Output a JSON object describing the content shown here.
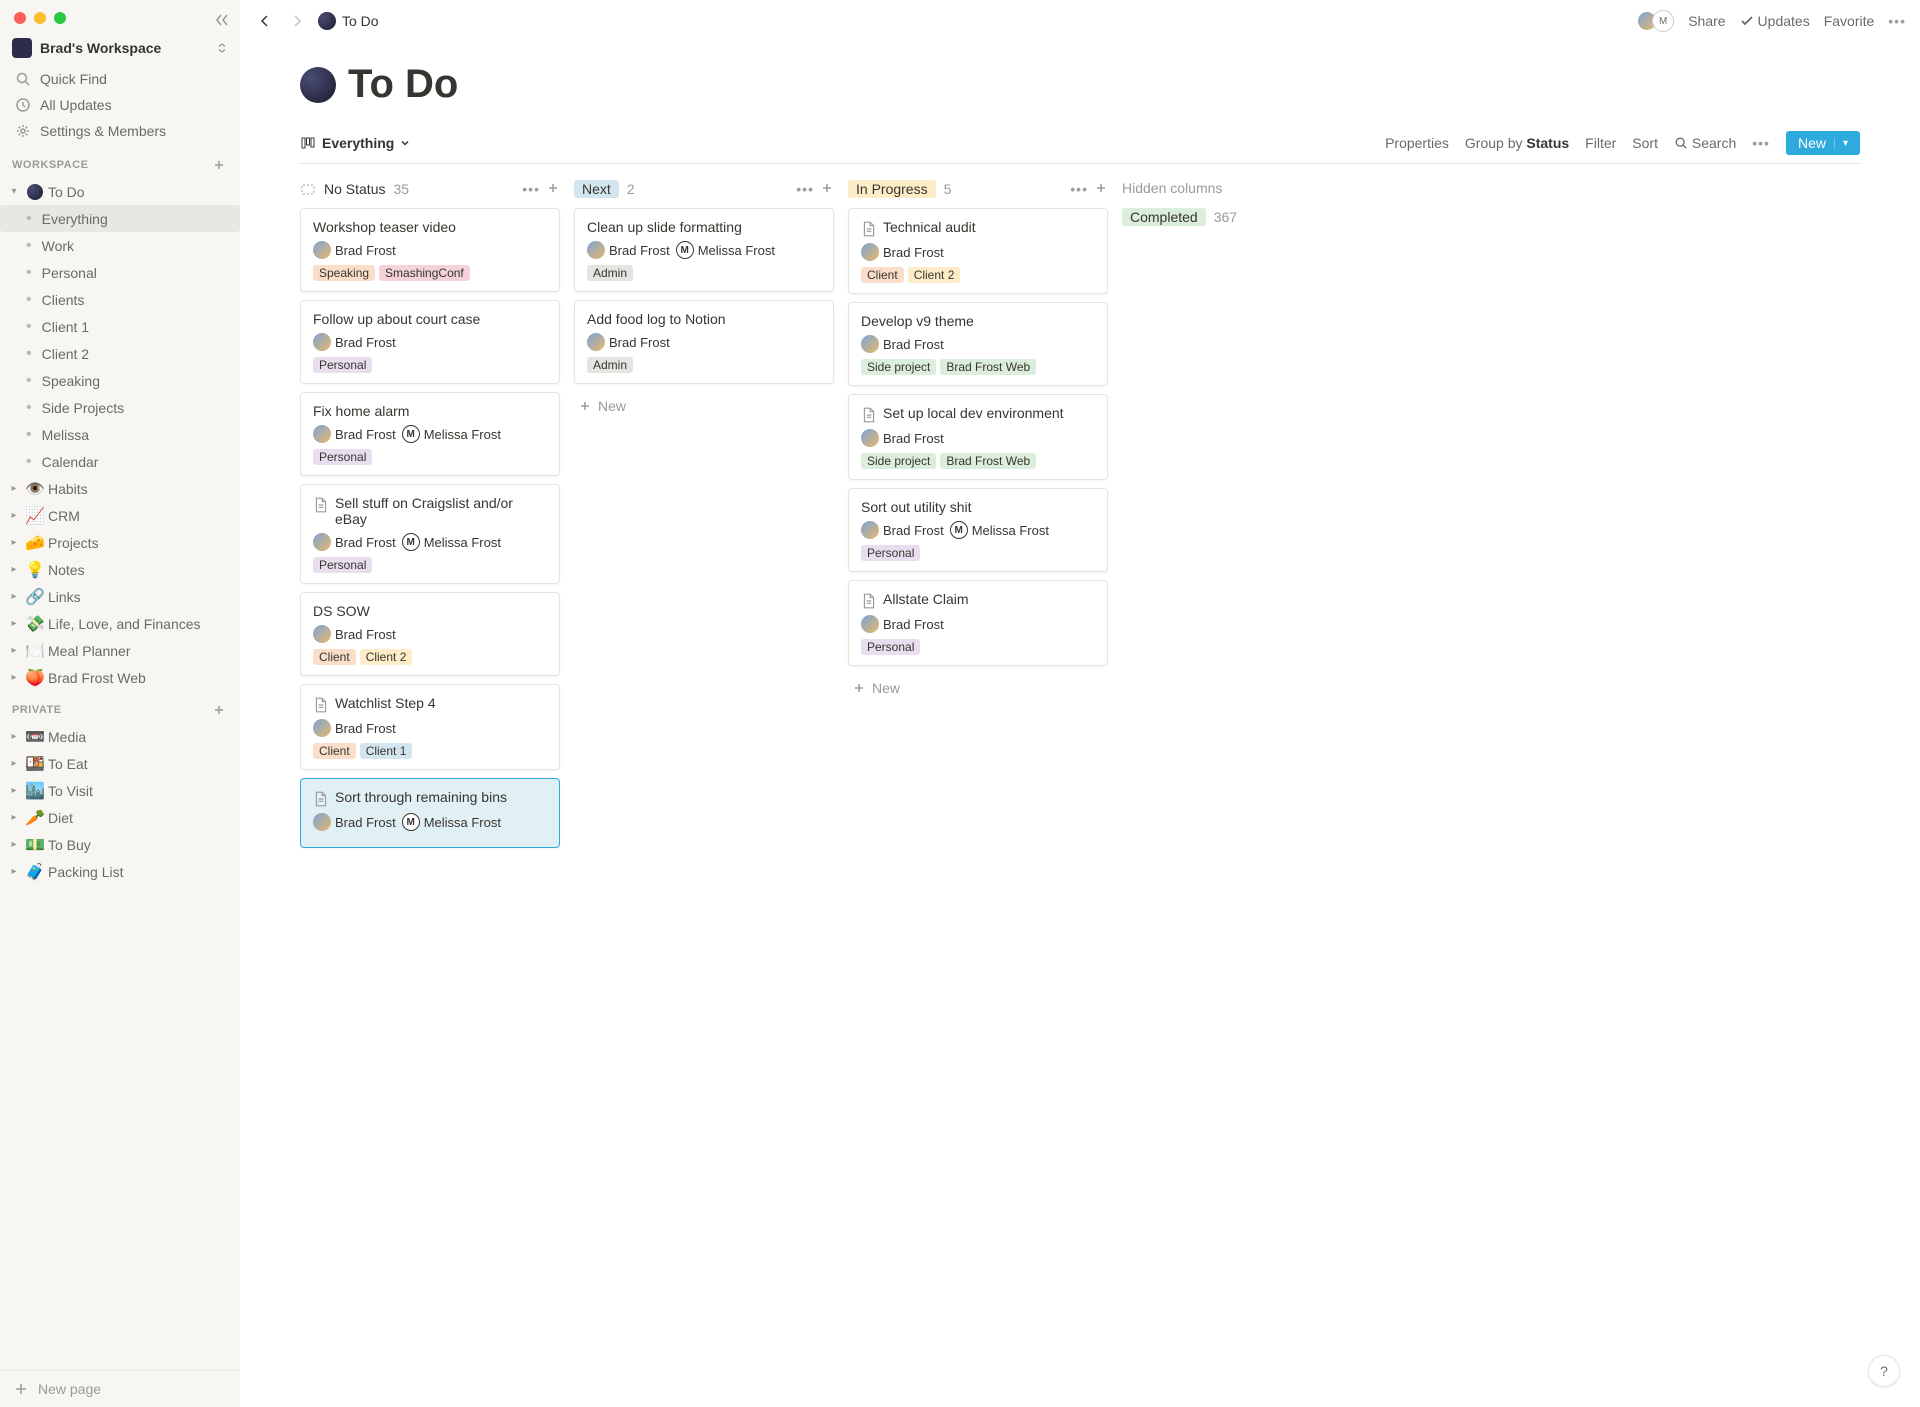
{
  "sidebar": {
    "workspace_name": "Brad's Workspace",
    "nav": {
      "quick_find": "Quick Find",
      "all_updates": "All Updates",
      "settings": "Settings & Members"
    },
    "workspace_label": "WORKSPACE",
    "workspace_pages": [
      {
        "icon": "moon",
        "label": "To Do",
        "expanded": true,
        "active": false,
        "sub": [
          {
            "label": "Everything",
            "active": true
          },
          {
            "label": "Work"
          },
          {
            "label": "Personal"
          },
          {
            "label": "Clients"
          },
          {
            "label": "Client 1"
          },
          {
            "label": "Client 2"
          },
          {
            "label": "Speaking"
          },
          {
            "label": "Side Projects"
          },
          {
            "label": "Melissa"
          },
          {
            "label": "Calendar"
          }
        ]
      },
      {
        "icon": "👁️",
        "label": "Habits"
      },
      {
        "icon": "📈",
        "label": "CRM"
      },
      {
        "icon": "🧀",
        "label": "Projects"
      },
      {
        "icon": "💡",
        "label": "Notes"
      },
      {
        "icon": "🔗",
        "label": "Links"
      },
      {
        "icon": "💸",
        "label": "Life, Love, and Finances"
      },
      {
        "icon": "🍽️",
        "label": "Meal Planner"
      },
      {
        "icon": "🍑",
        "label": "Brad Frost Web"
      }
    ],
    "private_label": "PRIVATE",
    "private_pages": [
      {
        "icon": "📼",
        "label": "Media"
      },
      {
        "icon": "🍱",
        "label": "To Eat"
      },
      {
        "icon": "🏙️",
        "label": "To Visit"
      },
      {
        "icon": "🥕",
        "label": "Diet"
      },
      {
        "icon": "💵",
        "label": "To Buy"
      },
      {
        "icon": "🧳",
        "label": "Packing List"
      }
    ],
    "new_page": "New page"
  },
  "topbar": {
    "breadcrumb": "To Do",
    "share": "Share",
    "updates": "Updates",
    "favorite": "Favorite"
  },
  "page": {
    "title": "To Do",
    "view_name": "Everything",
    "actions": {
      "properties": "Properties",
      "group_by_label": "Group by",
      "group_by_value": "Status",
      "filter": "Filter",
      "sort": "Sort",
      "search": "Search",
      "new": "New"
    }
  },
  "board": {
    "columns": [
      {
        "key": "no_status",
        "title": "No Status",
        "count": "35",
        "pill": null,
        "has_empty_icon": true,
        "cards": [
          {
            "title": "Workshop teaser video",
            "doc": false,
            "assignees": [
              {
                "name": "Brad Frost",
                "avatar": "bf"
              }
            ],
            "tags": [
              {
                "text": "Speaking",
                "cls": "tag-orange"
              },
              {
                "text": "SmashingConf",
                "cls": "tag-pink"
              }
            ]
          },
          {
            "title": "Follow up about court case",
            "doc": false,
            "assignees": [
              {
                "name": "Brad Frost",
                "avatar": "bf"
              }
            ],
            "tags": [
              {
                "text": "Personal",
                "cls": "tag-purple"
              }
            ]
          },
          {
            "title": "Fix home alarm",
            "doc": false,
            "assignees": [
              {
                "name": "Brad Frost",
                "avatar": "bf"
              },
              {
                "name": "Melissa Frost",
                "avatar": "m"
              }
            ],
            "tags": [
              {
                "text": "Personal",
                "cls": "tag-purple"
              }
            ]
          },
          {
            "title": "Sell stuff on Craigslist and/or eBay",
            "doc": true,
            "assignees": [
              {
                "name": "Brad Frost",
                "avatar": "bf"
              },
              {
                "name": "Melissa Frost",
                "avatar": "m"
              }
            ],
            "tags": [
              {
                "text": "Personal",
                "cls": "tag-purple"
              }
            ]
          },
          {
            "title": "DS SOW",
            "doc": false,
            "assignees": [
              {
                "name": "Brad Frost",
                "avatar": "bf"
              }
            ],
            "tags": [
              {
                "text": "Client",
                "cls": "tag-peach"
              },
              {
                "text": "Client 2",
                "cls": "tag-yellow"
              }
            ]
          },
          {
            "title": "Watchlist Step 4",
            "doc": true,
            "assignees": [
              {
                "name": "Brad Frost",
                "avatar": "bf"
              }
            ],
            "tags": [
              {
                "text": "Client",
                "cls": "tag-peach"
              },
              {
                "text": "Client 1",
                "cls": "tag-teal"
              }
            ]
          },
          {
            "title": "Sort through remaining bins",
            "doc": true,
            "selected": true,
            "assignees": [
              {
                "name": "Brad Frost",
                "avatar": "bf"
              },
              {
                "name": "Melissa Frost",
                "avatar": "m"
              }
            ],
            "tags": []
          }
        ]
      },
      {
        "key": "next",
        "title": "Next",
        "count": "2",
        "pill": "pill-blue",
        "cards": [
          {
            "title": "Clean up slide formatting",
            "doc": false,
            "assignees": [
              {
                "name": "Brad Frost",
                "avatar": "bf"
              },
              {
                "name": "Melissa Frost",
                "avatar": "m"
              }
            ],
            "tags": [
              {
                "text": "Admin",
                "cls": "tag-gray"
              }
            ]
          },
          {
            "title": "Add food log to Notion",
            "doc": false,
            "assignees": [
              {
                "name": "Brad Frost",
                "avatar": "bf"
              }
            ],
            "tags": [
              {
                "text": "Admin",
                "cls": "tag-gray"
              }
            ]
          }
        ],
        "show_add": true
      },
      {
        "key": "in_progress",
        "title": "In Progress",
        "count": "5",
        "pill": "pill-yellow",
        "cards": [
          {
            "title": "Technical audit",
            "doc": true,
            "assignees": [
              {
                "name": "Brad Frost",
                "avatar": "bf"
              }
            ],
            "tags": [
              {
                "text": "Client",
                "cls": "tag-peach"
              },
              {
                "text": "Client 2",
                "cls": "tag-yellow"
              }
            ]
          },
          {
            "title": "Develop v9 theme",
            "doc": false,
            "assignees": [
              {
                "name": "Brad Frost",
                "avatar": "bf"
              }
            ],
            "tags": [
              {
                "text": "Side project",
                "cls": "tag-green"
              },
              {
                "text": "Brad Frost Web",
                "cls": "tag-green"
              }
            ]
          },
          {
            "title": "Set up local dev environment",
            "doc": true,
            "assignees": [
              {
                "name": "Brad Frost",
                "avatar": "bf"
              }
            ],
            "tags": [
              {
                "text": "Side project",
                "cls": "tag-green"
              },
              {
                "text": "Brad Frost Web",
                "cls": "tag-green"
              }
            ]
          },
          {
            "title": "Sort out utility shit",
            "doc": false,
            "assignees": [
              {
                "name": "Brad Frost",
                "avatar": "bf"
              },
              {
                "name": "Melissa Frost",
                "avatar": "m"
              }
            ],
            "tags": [
              {
                "text": "Personal",
                "cls": "tag-purple"
              }
            ]
          },
          {
            "title": "Allstate Claim",
            "doc": true,
            "assignees": [
              {
                "name": "Brad Frost",
                "avatar": "bf"
              }
            ],
            "tags": [
              {
                "text": "Personal",
                "cls": "tag-purple"
              }
            ]
          }
        ],
        "show_add": true
      }
    ],
    "hidden": {
      "label": "Hidden columns",
      "items": [
        {
          "title": "Completed",
          "count": "367",
          "pill": "pill-green"
        }
      ]
    },
    "new_label": "New"
  }
}
